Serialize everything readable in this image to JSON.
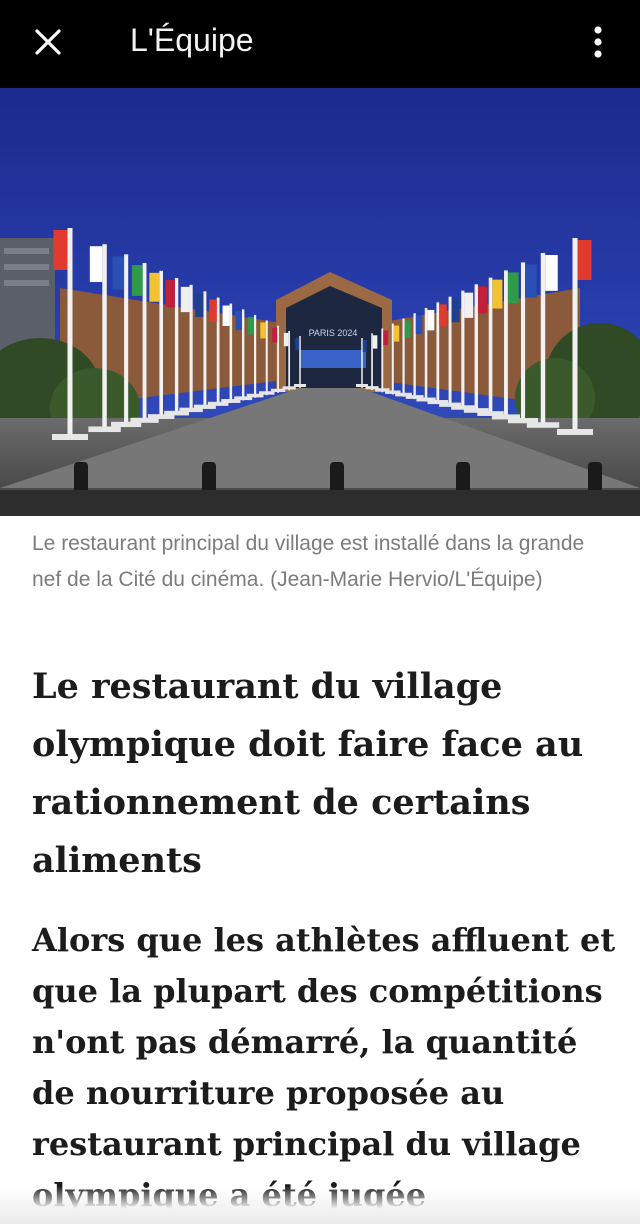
{
  "topbar": {
    "title": "L'Équipe",
    "close_icon": "close-icon",
    "more_icon": "more-vertical-icon"
  },
  "hero": {
    "sign_text": "PARIS 2024"
  },
  "article": {
    "caption": "Le restaurant principal du village est installé dans la grande nef de la Cité du cinéma. (Jean-Marie Hervio/L'Équipe)",
    "headline": "Le restaurant du village olympique doit faire face au rationnement de certains aliments",
    "lead": "Alors que les athlètes affluent et que la plupart des compétitions n'ont pas démarré, la quantité de nourriture proposée au restaurant principal du village olympique a été jugée"
  },
  "colors": {
    "topbar_bg": "#000000",
    "caption": "#7c7c7c",
    "text": "#1c1c1c"
  }
}
